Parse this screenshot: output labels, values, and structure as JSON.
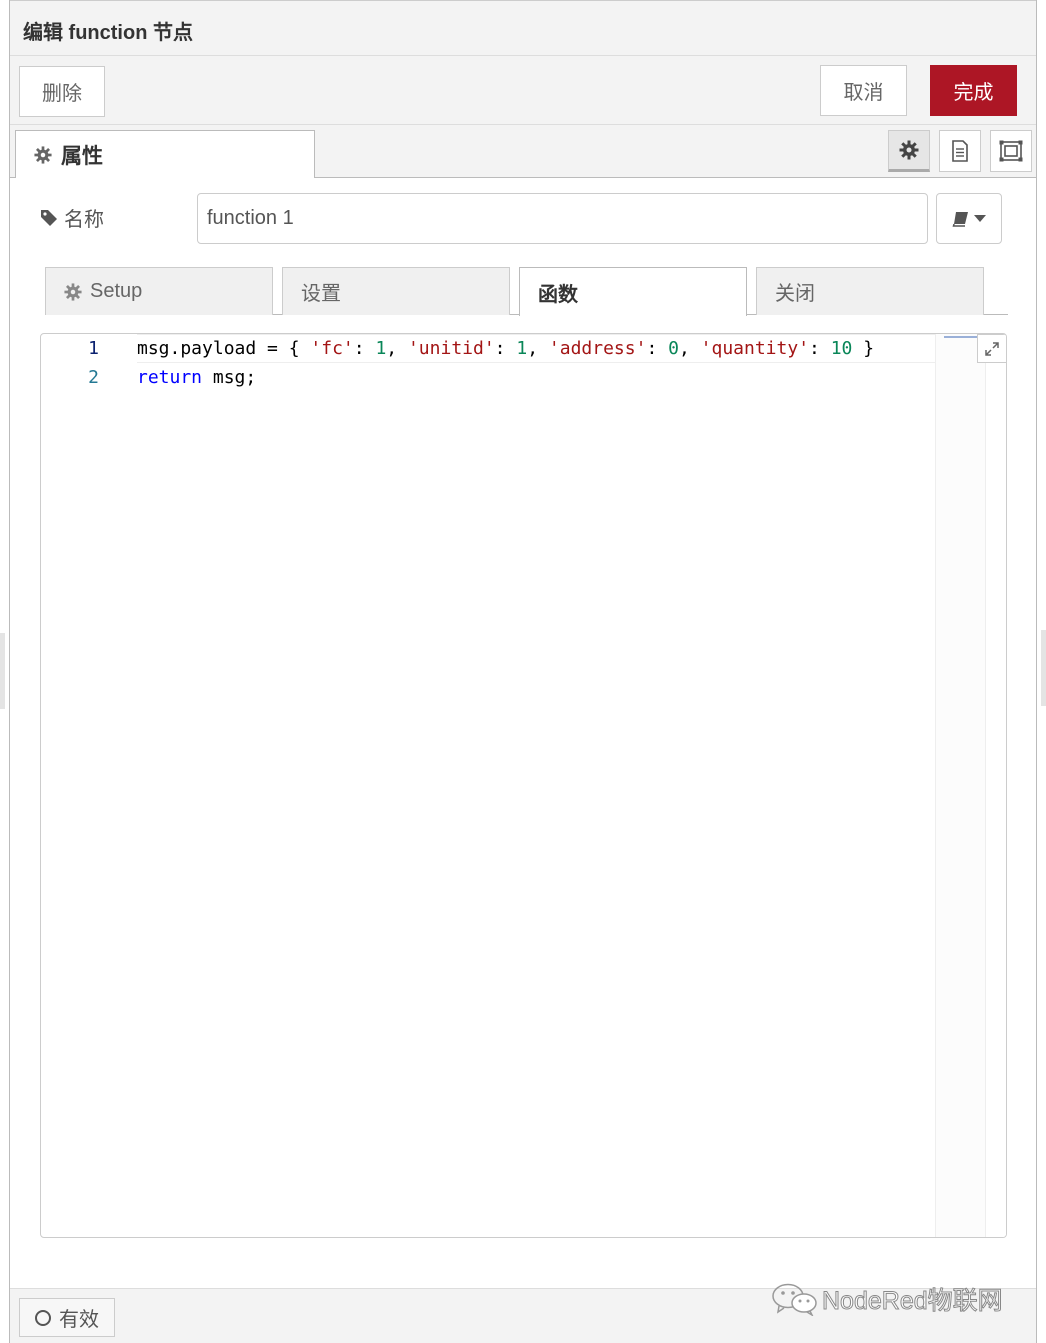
{
  "header": {
    "title": "编辑 function 节点"
  },
  "toolbar": {
    "delete_label": "删除",
    "cancel_label": "取消",
    "done_label": "完成",
    "done_color": "#ad1625"
  },
  "tabs": {
    "properties_label": "属性"
  },
  "side_icons": [
    "gear-icon",
    "description-icon",
    "appearance-icon"
  ],
  "name_field": {
    "label": "名称",
    "value": "function 1"
  },
  "subtabs": [
    {
      "label": "Setup"
    },
    {
      "label": "设置"
    },
    {
      "label": "函数",
      "active": true
    },
    {
      "label": "关闭"
    }
  ],
  "editor": {
    "line_numbers": [
      "1",
      "2"
    ],
    "lines": [
      [
        {
          "t": "msg.payload = { ",
          "c": ""
        },
        {
          "t": "'fc'",
          "c": "str"
        },
        {
          "t": ": ",
          "c": ""
        },
        {
          "t": "1",
          "c": "num"
        },
        {
          "t": ", ",
          "c": ""
        },
        {
          "t": "'unitid'",
          "c": "str"
        },
        {
          "t": ": ",
          "c": ""
        },
        {
          "t": "1",
          "c": "num"
        },
        {
          "t": ", ",
          "c": ""
        },
        {
          "t": "'address'",
          "c": "str"
        },
        {
          "t": ": ",
          "c": ""
        },
        {
          "t": "0",
          "c": "num"
        },
        {
          "t": ", ",
          "c": ""
        },
        {
          "t": "'quantity'",
          "c": "str"
        },
        {
          "t": ": ",
          "c": ""
        },
        {
          "t": "10",
          "c": "num"
        },
        {
          "t": " }",
          "c": ""
        }
      ],
      [
        {
          "t": "return",
          "c": "kw"
        },
        {
          "t": " msg;",
          "c": ""
        }
      ]
    ]
  },
  "footer": {
    "enabled_label": "有效"
  },
  "watermark": {
    "text": "NodeRed物联网"
  }
}
